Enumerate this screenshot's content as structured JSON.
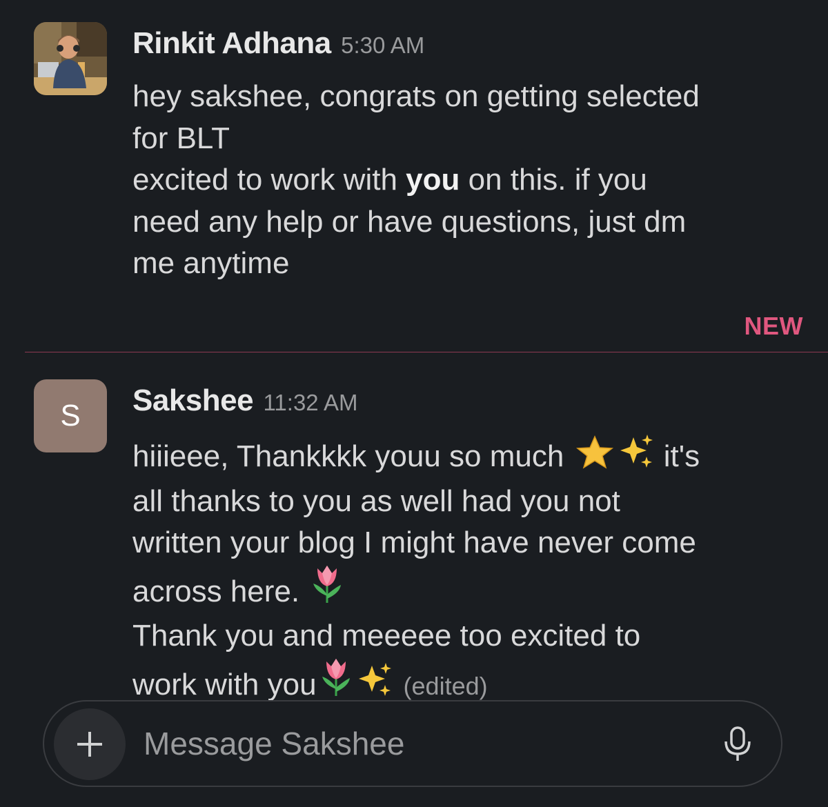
{
  "messages": [
    {
      "author": "Rinkit Adhana",
      "time": "5:30 AM",
      "avatar": "profile-photo",
      "lines": [
        [
          "hey sakshee, congrats on getting selected"
        ],
        [
          "for BLT"
        ],
        [
          "excited to work with ",
          "you",
          " on this. if you"
        ],
        [
          "need any help or have questions, just dm"
        ],
        [
          "me anytime"
        ]
      ]
    },
    {
      "author": "Sakshee",
      "time": "11:32 AM",
      "avatar_letter": "S",
      "lines": [
        [
          "hiiieee, Thankkkk youu so much",
          "it's"
        ],
        [
          "all thanks to you as well had you not"
        ],
        [
          "written your blog I might have never come"
        ],
        [
          "across here."
        ],
        [
          "Thank you and meeeee too excited to"
        ],
        [
          "work with you"
        ]
      ],
      "edited": "(edited)",
      "emojis": [
        "star-icon",
        "sparkles-icon",
        "tulip-icon",
        "tulip-icon",
        "sparkles-icon"
      ]
    }
  ],
  "new_label": "NEW",
  "composer": {
    "placeholder": "Message Sakshee",
    "plus_icon": "plus-icon",
    "mic_icon": "microphone-icon"
  },
  "colors": {
    "background": "#1a1d21",
    "new_accent": "#e0577f",
    "letter_avatar": "#917a70"
  }
}
